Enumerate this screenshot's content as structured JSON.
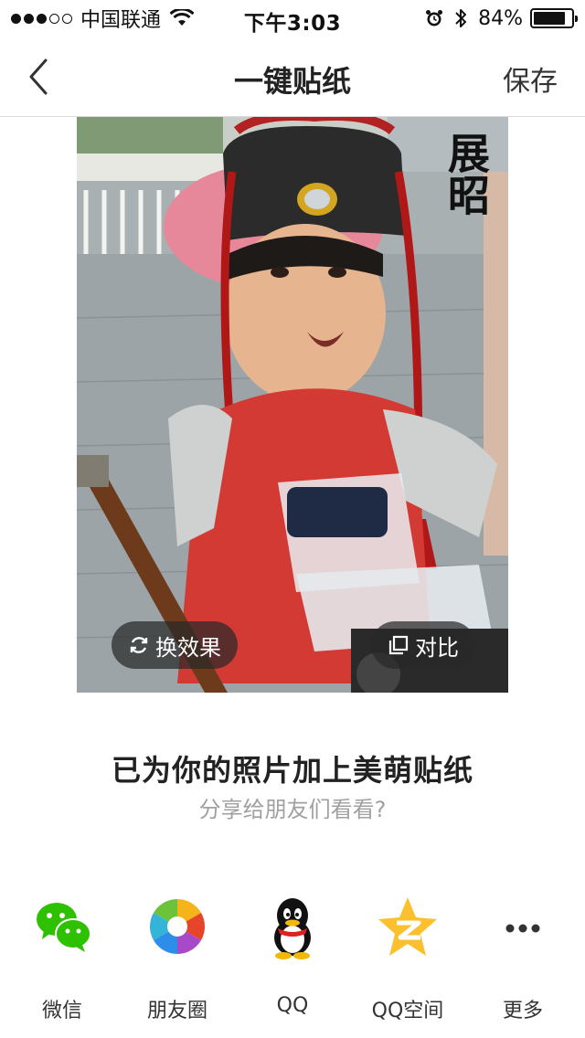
{
  "status_bar": {
    "carrier": "中国联通",
    "time": "下午3:03",
    "battery_percent": "84%",
    "battery_level": 0.84,
    "signal_bars_filled": 3,
    "signal_bars_total": 5
  },
  "nav": {
    "back_icon": "chevron-left-icon",
    "title": "一键贴纸",
    "save_label": "保存"
  },
  "photo": {
    "sticker_text": "展昭",
    "swap_effect_label": "换效果",
    "compare_label": "对比"
  },
  "message": {
    "headline": "已为你的照片加上美萌贴纸",
    "subline": "分享给朋友们看看?"
  },
  "share": [
    {
      "label": "微信",
      "icon": "wechat-icon"
    },
    {
      "label": "朋友圈",
      "icon": "moments-icon"
    },
    {
      "label": "QQ",
      "icon": "qq-icon"
    },
    {
      "label": "QQ空间",
      "icon": "qzone-icon"
    },
    {
      "label": "更多",
      "icon": "more-icon"
    }
  ]
}
